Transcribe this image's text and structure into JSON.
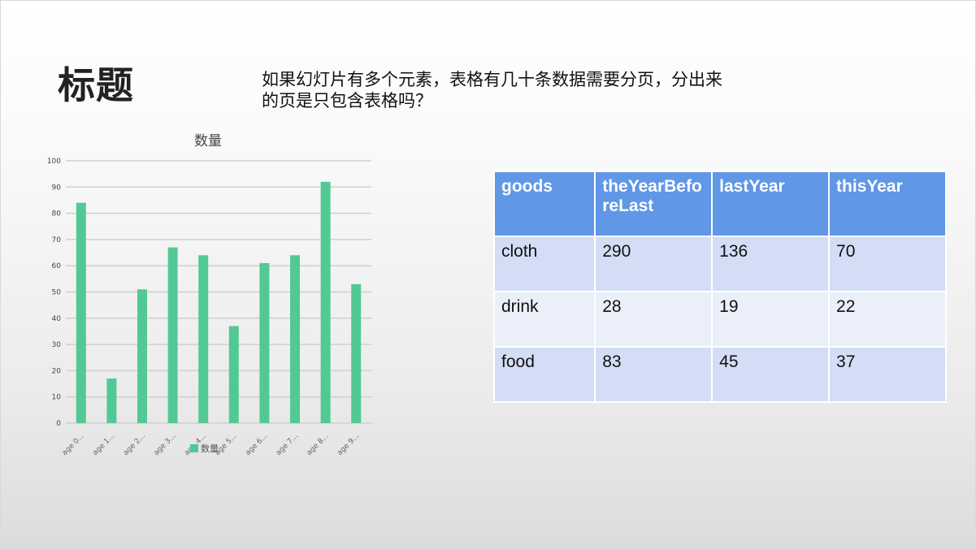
{
  "slide": {
    "title": "标题",
    "text": "如果幻灯片有多个元素，表格有几十条数据需要分页，分出来的页是只包含表格吗？"
  },
  "chart_data": {
    "type": "bar",
    "title": "数量",
    "categories": [
      "age 0...",
      "age 1...",
      "age 2...",
      "age 3...",
      "age 4...",
      "age 5...",
      "age 6...",
      "age 7...",
      "age 8...",
      "age 9..."
    ],
    "series": [
      {
        "name": "数量",
        "values": [
          84,
          17,
          51,
          67,
          64,
          37,
          61,
          64,
          92,
          53
        ]
      }
    ],
    "ylim": [
      0,
      100
    ],
    "yticks": [
      0,
      10,
      20,
      30,
      40,
      50,
      60,
      70,
      80,
      90,
      100
    ],
    "grid": true,
    "legend": "bottom",
    "color": "#52c994"
  },
  "table": {
    "headers": [
      "goods",
      "theYearBeforeLast",
      "lastYear",
      "thisYear"
    ],
    "rows": [
      [
        "cloth",
        "290",
        "136",
        "70"
      ],
      [
        "drink",
        "28",
        "19",
        "22"
      ],
      [
        "food",
        "83",
        "45",
        "37"
      ]
    ],
    "header_color": "#6097e6"
  }
}
